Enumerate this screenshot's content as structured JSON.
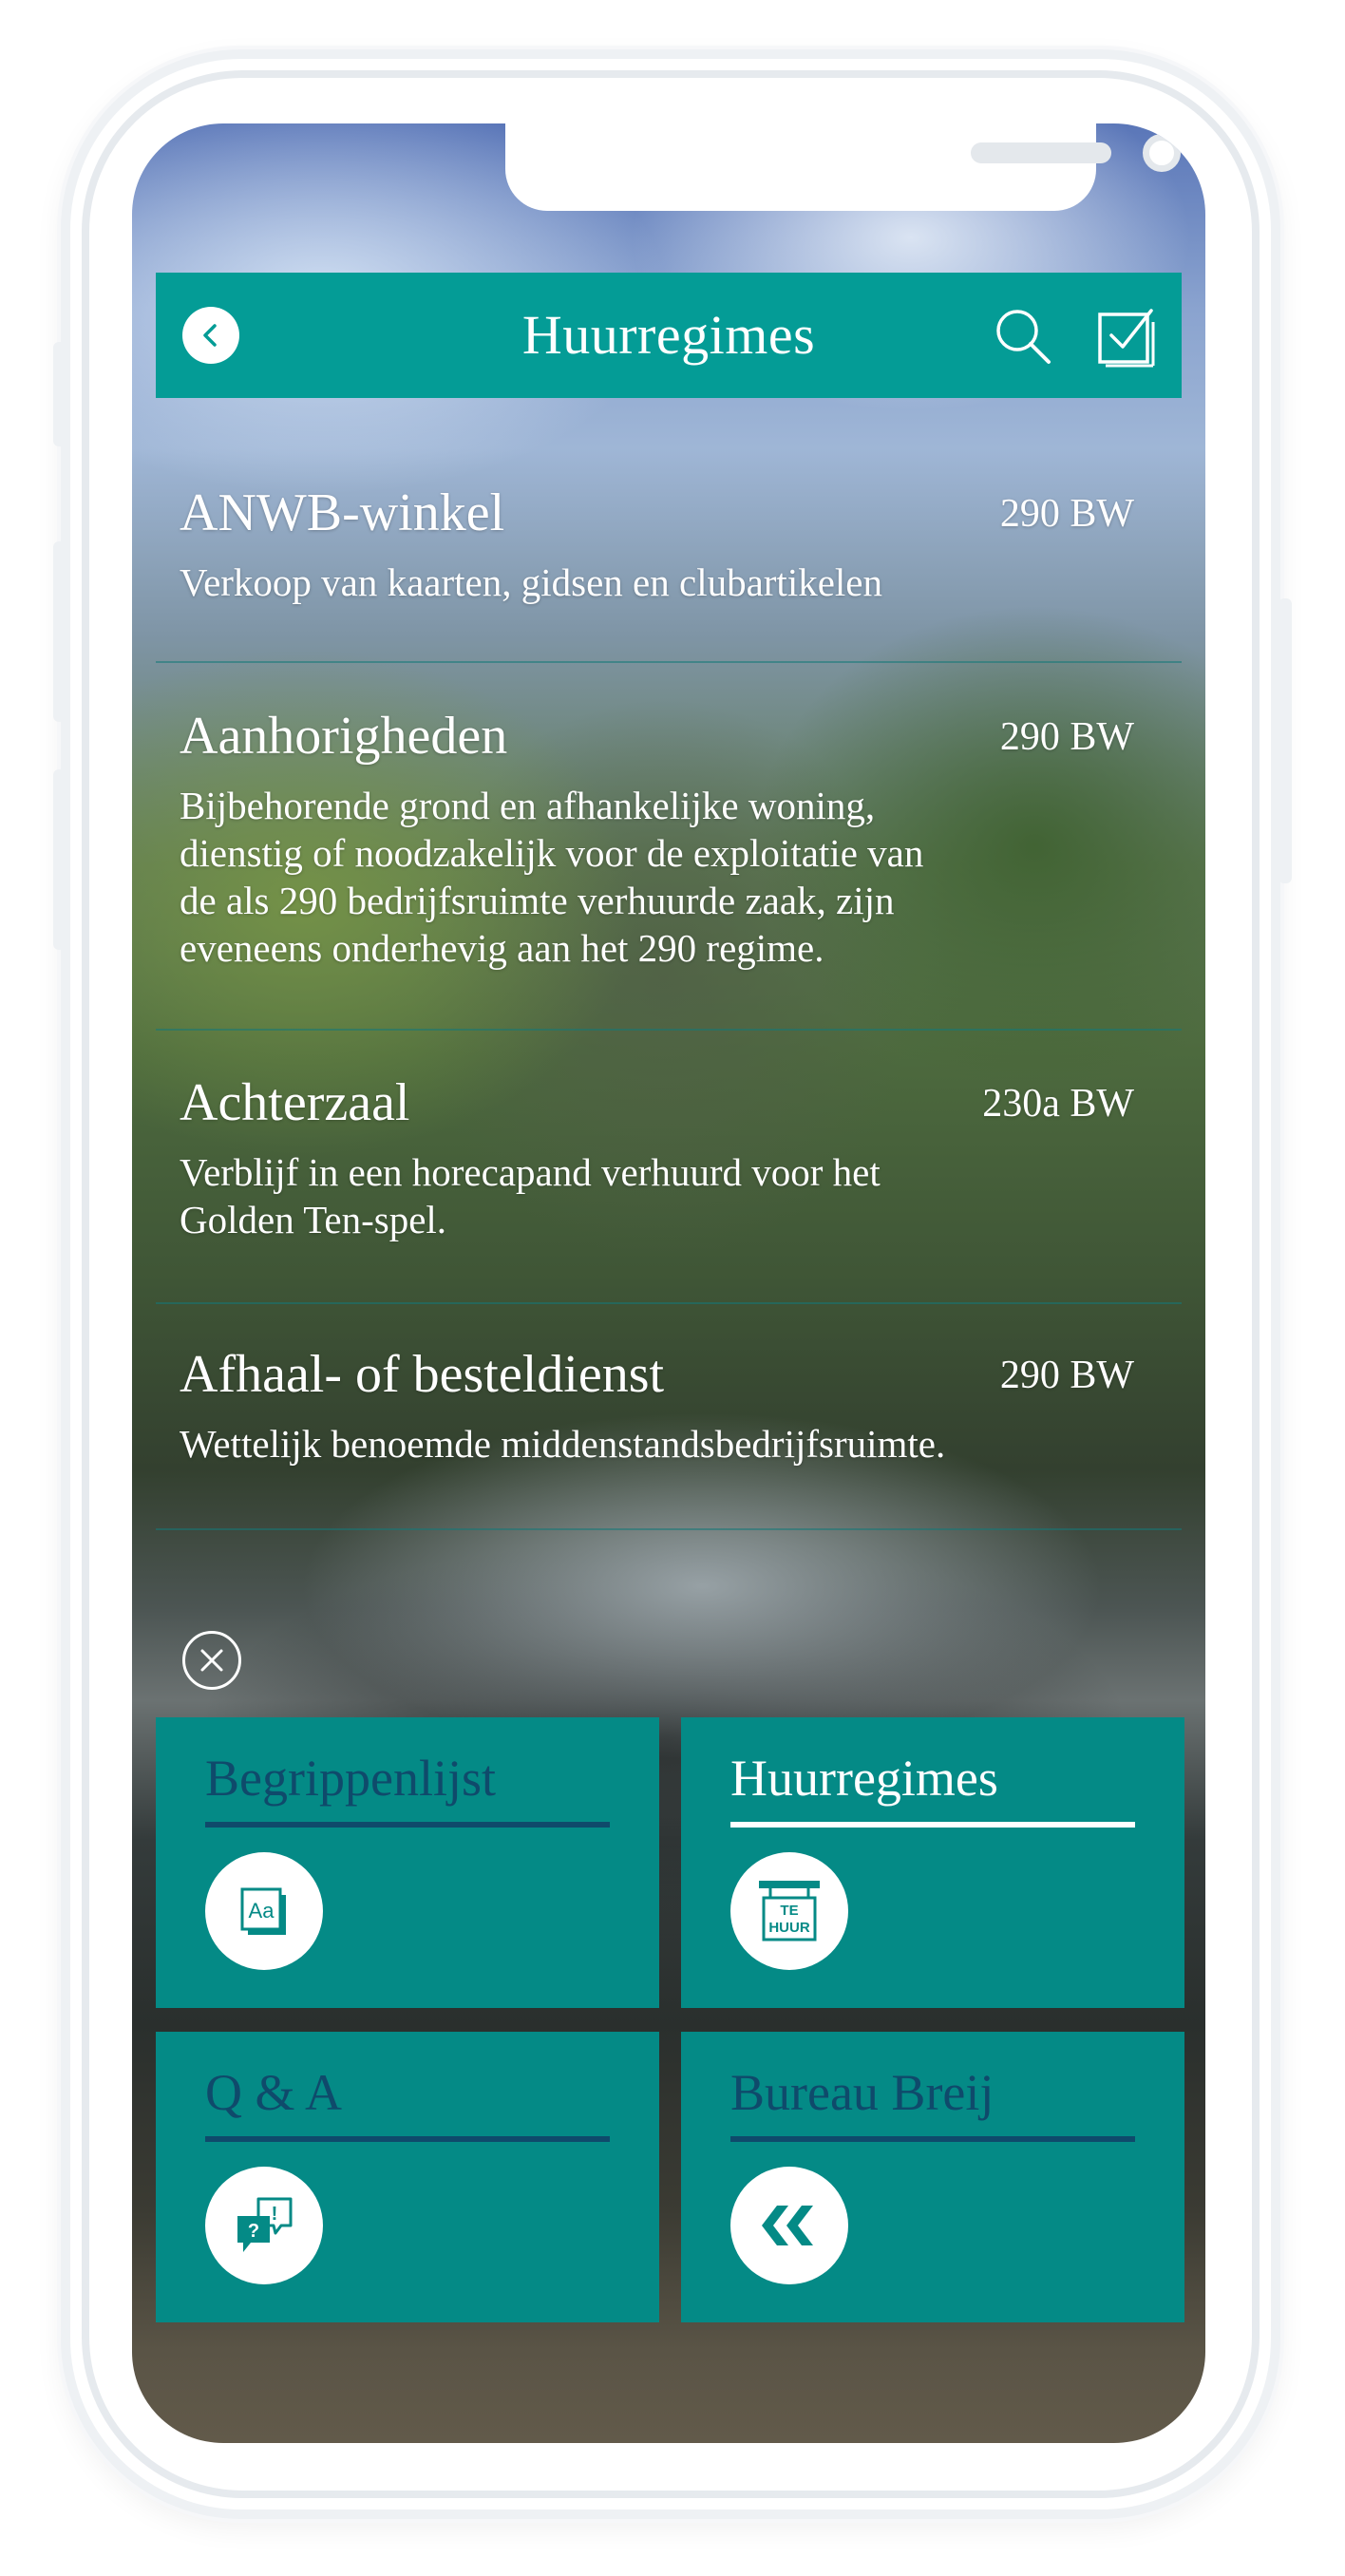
{
  "header": {
    "title": "Huurregimes",
    "back_icon": "chevron-left-icon",
    "search_icon": "search-icon",
    "checklist_icon": "checkbox-icon"
  },
  "entries": [
    {
      "title": "ANWB-winkel",
      "code": "290 BW",
      "description": "Verkoop van kaarten, gidsen en clubartikelen"
    },
    {
      "title": "Aanhorigheden",
      "code": "290 BW",
      "description_lines": [
        "Bijbehorende grond en afhankelijke woning,",
        "dienstig of noodzakelijk voor de exploitatie van",
        "de als 290 bedrijfsruimte verhuurde zaak, zijn",
        "eveneens onderhevig aan het 290 regime."
      ]
    },
    {
      "title": "Achterzaal",
      "code": "230a BW",
      "description_lines": [
        "Verblijf in een horecapand verhuurd voor het",
        "Golden Ten-spel."
      ]
    },
    {
      "title": "Afhaal- of besteldienst",
      "code": "290 BW",
      "description": "Wettelijk benoemde middenstandsbedrijfsruimte."
    }
  ],
  "menu": {
    "close_icon": "close-circle-icon",
    "tiles": [
      {
        "label": "Begrippenlijst",
        "icon": "glossary-aa-icon",
        "active": false
      },
      {
        "label": "Huurregimes",
        "icon": "te-huur-sign-icon",
        "icon_text_top": "TE",
        "icon_text_bottom": "HUUR",
        "active": true
      },
      {
        "label": "Q & A",
        "icon": "question-answer-bubbles-icon",
        "active": false
      },
      {
        "label": "Bureau Breij",
        "icon": "double-chevron-left-logo-icon",
        "active": false
      }
    ]
  },
  "colors": {
    "teal_header": "#049c96",
    "teal_tile": "#048a86",
    "inactive_label": "#0f4a6b",
    "text": "#ffffff"
  }
}
